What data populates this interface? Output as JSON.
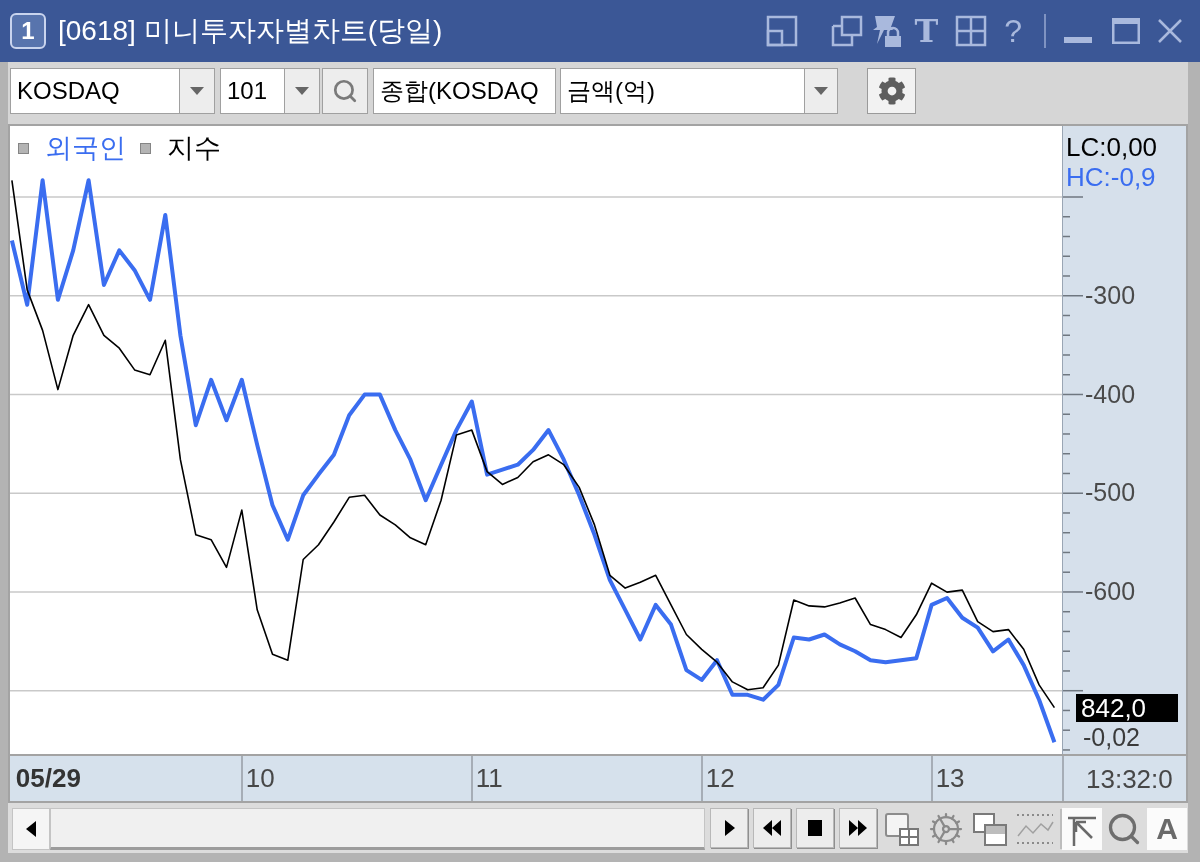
{
  "window": {
    "number": "1",
    "title": "[0618] 미니투자자별차트(당일)",
    "text_tool": "T",
    "help": "?"
  },
  "toolbar": {
    "market": {
      "value": "KOSDAQ"
    },
    "code": {
      "value": "101"
    },
    "name_field": {
      "value": "종합(KOSDAQ"
    },
    "unit": {
      "value": "금액(억)"
    }
  },
  "chart": {
    "lc_label": "LC:0,00",
    "hc_label": "HC:-0,9",
    "price_badge": "842,0",
    "change": "-0,02",
    "time": "13:32:0",
    "chart_data": {
      "type": "line",
      "grid": true,
      "x": [
        8.954,
        9.02,
        9.086,
        9.152,
        9.218,
        9.284,
        9.35,
        9.416,
        9.482,
        9.548,
        9.614,
        9.679,
        9.745,
        9.811,
        9.877,
        9.943,
        10.009,
        10.075,
        10.141,
        10.207,
        10.273,
        10.339,
        10.405,
        10.471,
        10.537,
        10.603,
        10.668,
        10.734,
        10.8,
        10.866,
        10.932,
        10.998,
        11.064,
        11.13,
        11.196,
        11.262,
        11.328,
        11.394,
        11.46,
        11.526,
        11.592,
        11.657,
        11.723,
        11.789,
        11.855,
        11.921,
        11.987,
        12.053,
        12.119,
        12.185,
        12.251,
        12.317,
        12.383,
        12.449,
        12.515,
        12.581,
        12.647,
        12.712,
        12.778,
        12.844,
        12.91,
        12.976,
        13.042,
        13.108,
        13.174,
        13.24,
        13.306,
        13.372,
        13.438
      ],
      "xlim": [
        8.946,
        14.004
      ],
      "ylim": [
        -764,
        -128
      ],
      "xticks": [
        {
          "value": 9,
          "label": "05/29"
        },
        10,
        11,
        12,
        13
      ],
      "yticks": [
        -300,
        -400,
        -500,
        -600
      ],
      "series": [
        {
          "name": "외국인",
          "color": "#3a6df0",
          "values": [
            -244,
            -309,
            -183,
            -304,
            -254,
            -183,
            -289,
            -254,
            -274,
            -304,
            -218,
            -340,
            -431,
            -385,
            -426,
            -385,
            -451,
            -512,
            -547,
            -502,
            -481,
            -461,
            -421,
            -400,
            -400,
            -436,
            -466,
            -507,
            -471,
            -436,
            -407,
            -481,
            -476,
            -471,
            -456,
            -436,
            -466,
            -502,
            -542,
            -588,
            -618,
            -648,
            -613,
            -633,
            -679,
            -689,
            -669,
            -704,
            -704,
            -709,
            -694,
            -646,
            -648,
            -643,
            -653,
            -660,
            -669,
            -671,
            -669,
            -667,
            -613,
            -606,
            -626,
            -636,
            -660,
            -648,
            -674,
            -709,
            -752
          ]
        },
        {
          "name": "지수",
          "color": "#000000",
          "values": [
            -183,
            -294,
            -335,
            -395,
            -340,
            -309,
            -340,
            -353,
            -375,
            -380,
            -345,
            -466,
            -542,
            -547,
            -575,
            -517,
            -618,
            -663,
            -669,
            -567,
            -552,
            -529,
            -504,
            -502,
            -522,
            -532,
            -545,
            -552,
            -507,
            -441,
            -436,
            -478,
            -491,
            -484,
            -468,
            -461,
            -471,
            -494,
            -532,
            -583,
            -596,
            -590,
            -583,
            -613,
            -643,
            -658,
            -671,
            -691,
            -699,
            -697,
            -674,
            -608,
            -614,
            -615,
            -611,
            -606,
            -633,
            -638,
            -646,
            -623,
            -591,
            -600,
            -598,
            -630,
            -640,
            -638,
            -658,
            -694,
            -717
          ]
        }
      ]
    }
  },
  "bottom_bar": {
    "font_tool": "A"
  }
}
